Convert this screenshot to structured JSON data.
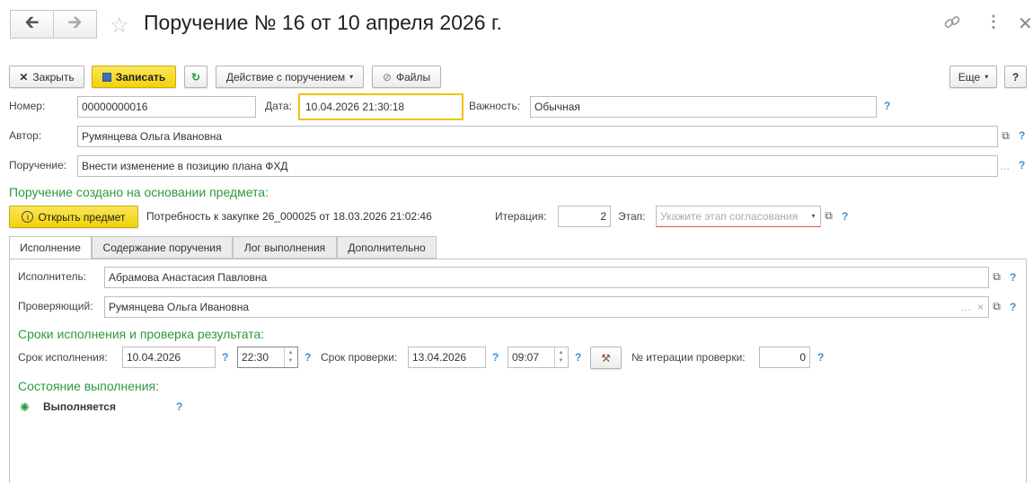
{
  "header": {
    "title": "Поручение № 16 от 10 апреля 2026 г.",
    "back_icon": "arrow-left-icon",
    "forward_icon": "arrow-right-icon",
    "star_icon": "star-icon",
    "link_icon": "link-icon",
    "more_icon": "more-vertical-icon",
    "close_icon": "close-icon"
  },
  "toolbar": {
    "close_label": "Закрыть",
    "save_label": "Записать",
    "action_label": "Действие с поручением",
    "files_label": "Файлы",
    "more_label": "Еще",
    "help_label": "?"
  },
  "form": {
    "number_label": "Номер:",
    "number_value": "00000000016",
    "date_label": "Дата:",
    "date_value": "10.04.2026 21:30:18",
    "importance_label": "Важность:",
    "importance_value": "Обычная",
    "author_label": "Автор:",
    "author_value": "Румянцева Ольга Ивановна",
    "task_label": "Поручение:",
    "task_value": "Внести изменение в позицию плана ФХД",
    "basis_heading": "Поручение создано на основании предмета:",
    "open_subject_label": "Открыть предмет",
    "subject_text": "Потребность к закупке 26_000025 от 18.03.2026 21:02:46",
    "iteration_label": "Итерация:",
    "iteration_value": "2",
    "stage_label": "Этап:",
    "stage_placeholder": "Укажите этап согласования",
    "help": "?"
  },
  "tabs": [
    {
      "label": "Исполнение",
      "active": true
    },
    {
      "label": "Содержание поручения",
      "active": false
    },
    {
      "label": "Лог выполнения",
      "active": false
    },
    {
      "label": "Дополнительно",
      "active": false
    }
  ],
  "execution": {
    "executor_label": "Исполнитель:",
    "executor_value": "Абрамова Анастасия Павловна",
    "checker_label": "Проверяющий:",
    "checker_value": "Румянцева Ольга Ивановна",
    "deadlines_heading": "Сроки исполнения и проверка результата:",
    "due_label": "Срок исполнения:",
    "due_date": "10.04.2026",
    "due_time": "22:30",
    "check_label": "Срок проверки:",
    "check_date": "13.04.2026",
    "check_time": "09:07",
    "check_iteration_label": "№ итерации проверки:",
    "check_iteration_value": "0",
    "status_heading": "Состояние выполнения:",
    "status_value": "Выполняется"
  },
  "colors": {
    "accent_yellow": "#f2d20a",
    "heading_green": "#2c9a3e",
    "help_blue": "#3b8fd6"
  }
}
